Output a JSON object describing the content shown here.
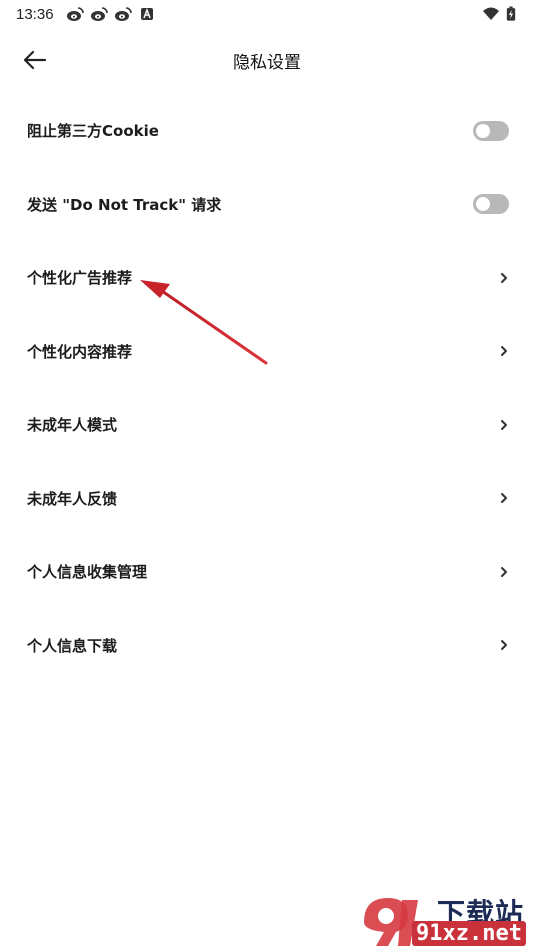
{
  "status_bar": {
    "time": "13:36",
    "left_icons": [
      "weibo-icon",
      "weibo-icon",
      "weibo-icon",
      "a-badge-icon"
    ],
    "right_icons": [
      "wifi-icon",
      "battery-charging-icon"
    ]
  },
  "header": {
    "title": "隐私设置",
    "back_icon": "arrow-left-icon"
  },
  "items": [
    {
      "label": "阻止第三方Cookie",
      "control": "toggle",
      "state": "off"
    },
    {
      "label": "发送 \"Do Not Track\" 请求",
      "control": "toggle",
      "state": "off"
    },
    {
      "label": "个性化广告推荐",
      "control": "chevron"
    },
    {
      "label": "个性化内容推荐",
      "control": "chevron"
    },
    {
      "label": "未成年人模式",
      "control": "chevron"
    },
    {
      "label": "未成年人反馈",
      "control": "chevron"
    },
    {
      "label": "个人信息收集管理",
      "control": "chevron"
    },
    {
      "label": "个人信息下载",
      "control": "chevron"
    }
  ],
  "colors": {
    "toggle_off": "#b8b8b8",
    "annotation_arrow": "#d6262e",
    "watermark_red": "#c9323a",
    "watermark_navy": "#1c2b55"
  },
  "watermark": {
    "top": "下载站",
    "bottom": "91xz.net"
  }
}
